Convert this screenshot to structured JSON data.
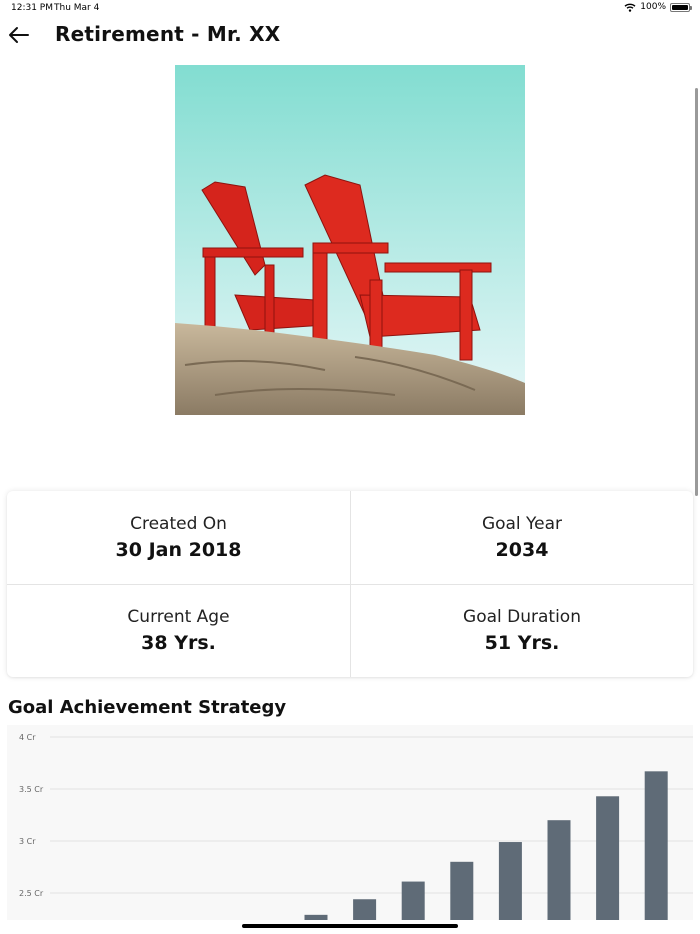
{
  "status_bar": {
    "time": "12:31 PM",
    "date": "Thu Mar 4",
    "battery": "100%",
    "battery_level": 1.0
  },
  "header": {
    "title": "Retirement - Mr. XX"
  },
  "hero": {
    "description_icon": "beach-chairs-photo"
  },
  "info": {
    "created_on_label": "Created On",
    "created_on_value": "30 Jan 2018",
    "goal_year_label": "Goal Year",
    "goal_year_value": "2034",
    "current_age_label": "Current Age",
    "current_age_value": "38 Yrs.",
    "goal_duration_label": "Goal Duration",
    "goal_duration_value": "51 Yrs."
  },
  "strategy": {
    "title": "Goal Achievement Strategy"
  },
  "chart_data": {
    "type": "bar",
    "title": "",
    "xlabel": "",
    "ylabel": "",
    "y_ticks": [
      "4 Cr",
      "3.5 Cr",
      "3 Cr",
      "2.5 Cr"
    ],
    "y_tick_values": [
      4.0,
      3.5,
      3.0,
      2.5
    ],
    "ylim": [
      2.25,
      4.0
    ],
    "categories": [
      "",
      "",
      "",
      "",
      "",
      "",
      "",
      ""
    ],
    "values": [
      2.29,
      2.44,
      2.61,
      2.8,
      2.99,
      3.2,
      3.43,
      3.67
    ],
    "color": "#5f6b77",
    "grid": true
  },
  "colors": {
    "bar": "#5f6b77",
    "chart_bg": "#f8f8f8",
    "grid": "#e2e2e2"
  }
}
